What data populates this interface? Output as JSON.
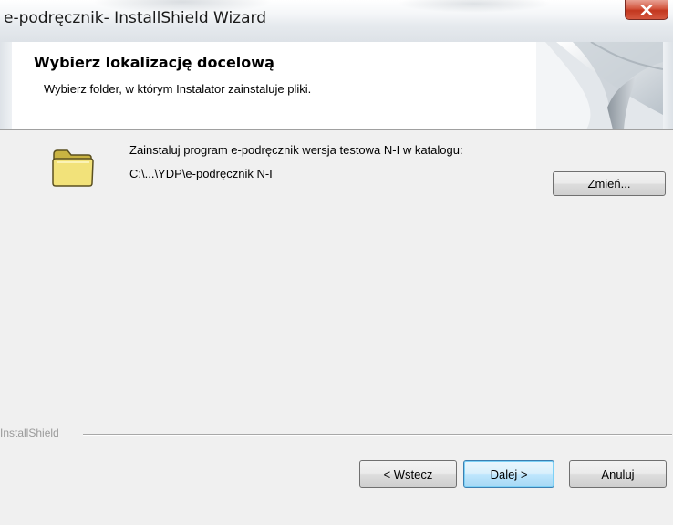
{
  "window": {
    "title": "e-podręcznik- InstallShield Wizard",
    "close_icon": "close-icon"
  },
  "banner": {
    "heading": "Wybierz lokalizację docelową",
    "subheading": "Wybierz folder, w którym Instalator zainstaluje pliki."
  },
  "body": {
    "folder_icon": "folder-icon",
    "install_label": "Zainstaluj program e-podręcznik wersja testowa N-I w katalogu:",
    "install_path": "C:\\...\\YDP\\e-podręcznik N-I",
    "change_button": "Zmień..."
  },
  "footer": {
    "brand": "InstallShield",
    "back_button": "< Wstecz",
    "next_button": "Dalej >",
    "cancel_button": "Anuluj"
  },
  "colors": {
    "close_button": "#c3371f",
    "default_button_border": "#3c7fb1",
    "folder": "#f2e27a"
  }
}
